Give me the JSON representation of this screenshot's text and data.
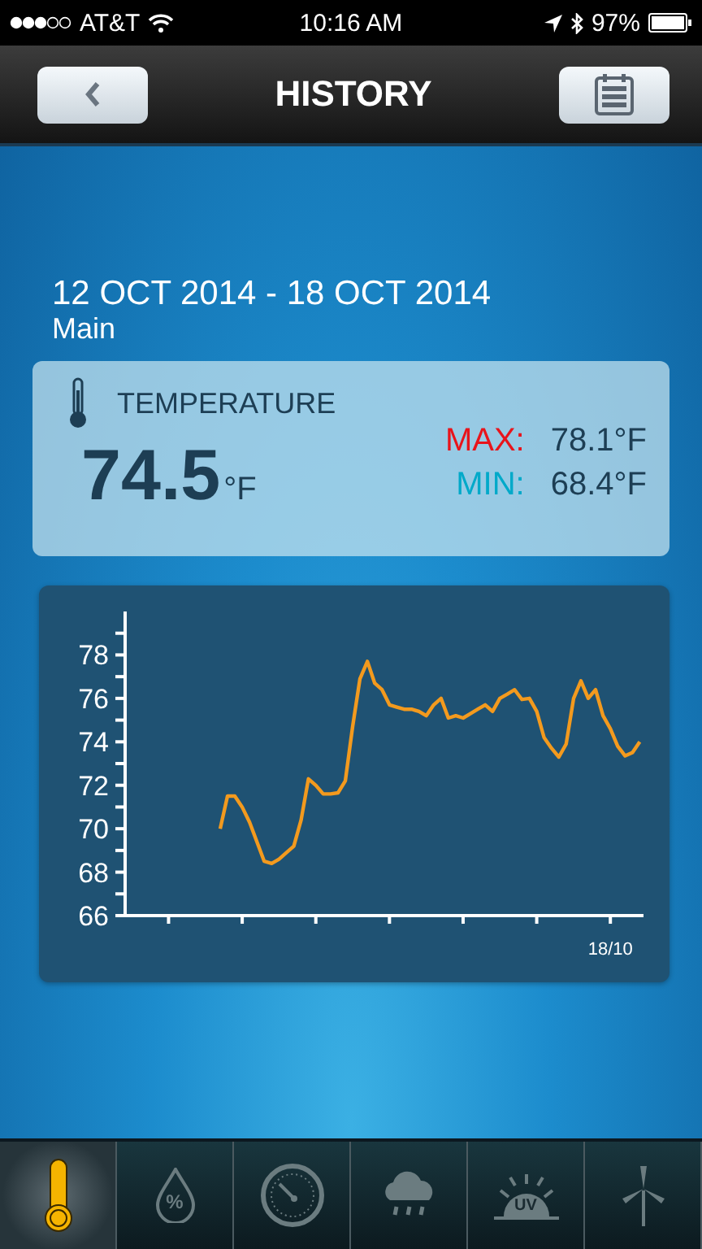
{
  "status_bar": {
    "carrier": "AT&T",
    "time": "10:16 AM",
    "battery": "97%"
  },
  "nav_bar": {
    "title": "HISTORY"
  },
  "period": {
    "range": "12 OCT 2014 - 18 OCT 2014",
    "location": "Main"
  },
  "summary": {
    "title": "TEMPERATURE",
    "current": "74.5",
    "unit": "°F",
    "max_label": "MAX:",
    "max_value": "78.1°F",
    "min_label": "MIN:",
    "min_value": "68.4°F"
  },
  "history_chart": {
    "chart_data": {
      "type": "line",
      "ylim": [
        66,
        80
      ],
      "yticks": [
        66,
        68,
        70,
        72,
        74,
        76,
        78
      ],
      "annotations": [
        "18/10"
      ],
      "series": [
        {
          "color": "#f39a1e",
          "values": [
            70.0,
            71.5,
            71.5,
            71.0,
            70.3,
            69.4,
            68.5,
            68.4,
            68.6,
            68.9,
            69.2,
            70.4,
            72.3,
            72.0,
            71.6,
            71.6,
            71.65,
            72.2,
            74.7,
            76.9,
            77.7,
            76.7,
            76.4,
            75.7,
            75.6,
            75.5,
            75.5,
            75.4,
            75.2,
            75.7,
            76.0,
            75.1,
            75.2,
            75.1,
            75.3,
            75.5,
            75.7,
            75.4,
            76.0,
            76.2,
            76.4,
            75.95,
            76.0,
            75.4,
            74.2,
            73.7,
            73.3,
            73.9,
            76.0,
            76.8,
            76.0,
            76.4,
            75.2,
            74.6,
            73.8,
            73.35,
            73.5,
            74.0
          ]
        }
      ]
    }
  },
  "tab_bar": [
    {
      "kind": "temperature",
      "selected": true
    },
    {
      "kind": "humidity",
      "label": "%",
      "selected": false
    },
    {
      "kind": "pressure",
      "selected": false
    },
    {
      "kind": "rain",
      "selected": false
    },
    {
      "kind": "uv",
      "label": "UV",
      "selected": false
    },
    {
      "kind": "wind",
      "selected": false
    }
  ]
}
